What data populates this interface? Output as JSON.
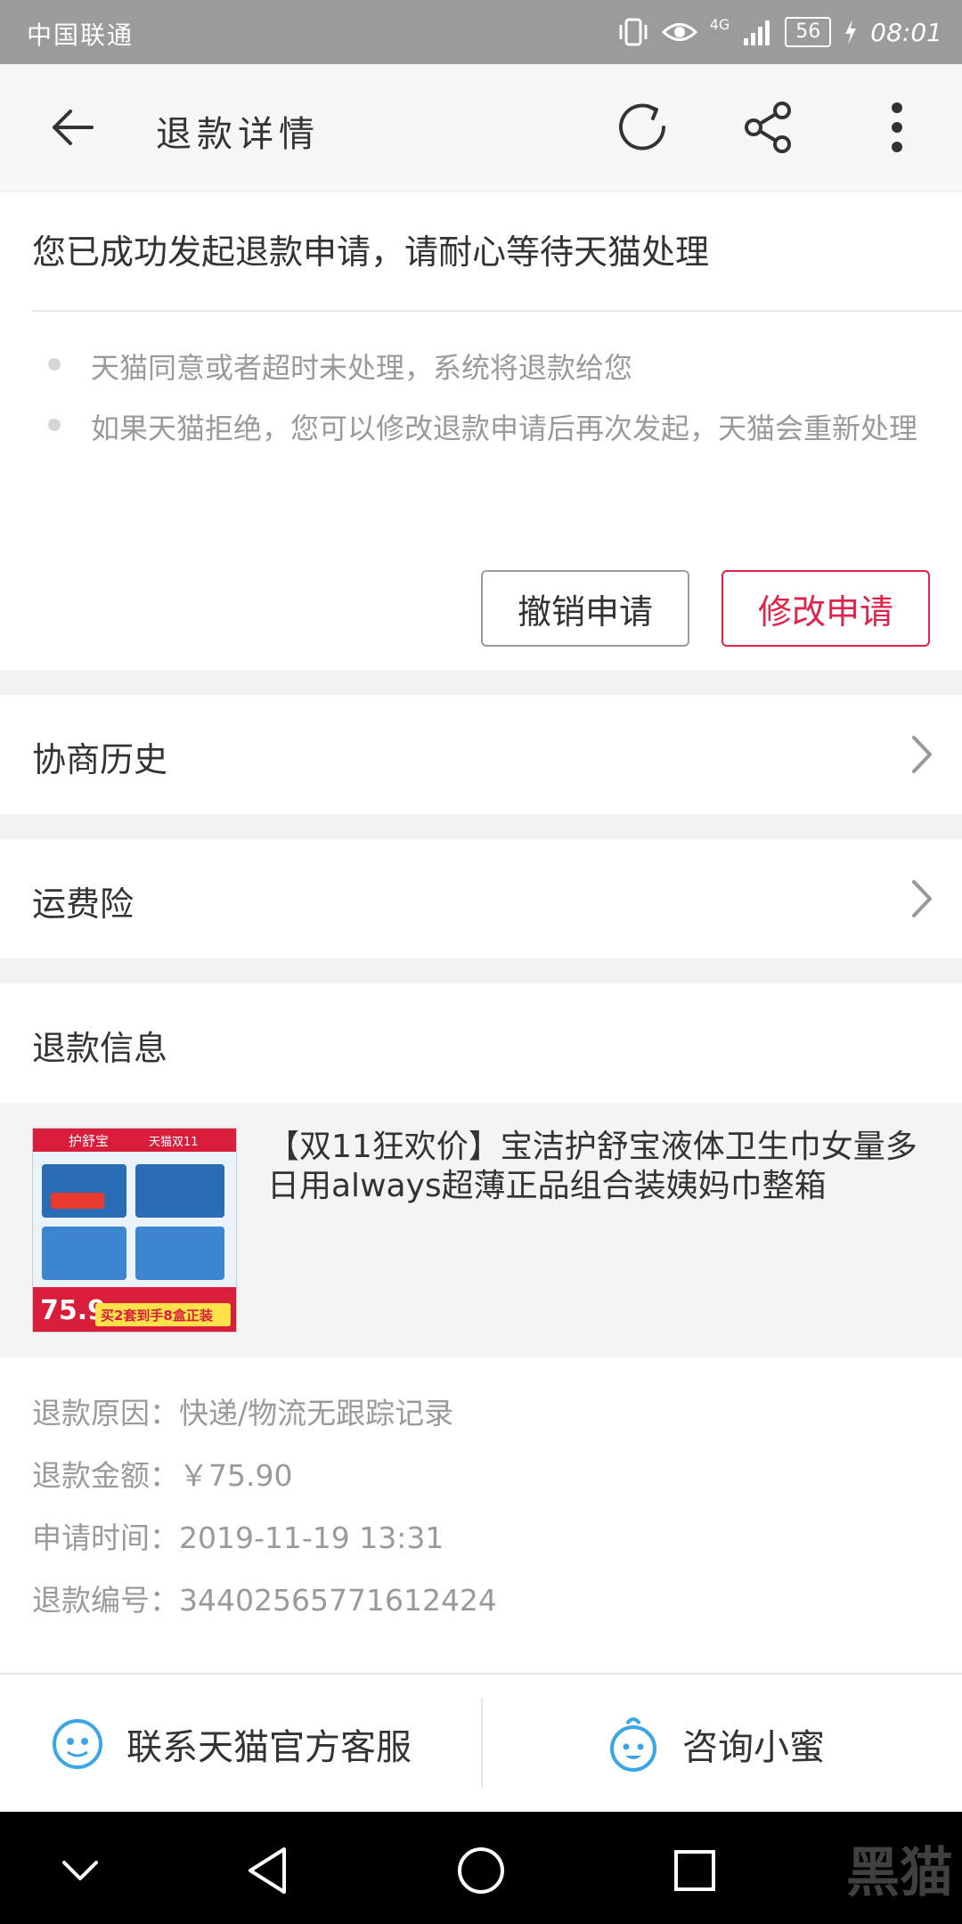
{
  "statusbar": {
    "carrier": "中国联通",
    "network": "4G",
    "battery": "56",
    "time": "08:01"
  },
  "header": {
    "title": "退款详情"
  },
  "notice": {
    "headline": "您已成功发起退款申请，请耐心等待天猫处理",
    "bullets": [
      "天猫同意或者超时未处理，系统将退款给您",
      "如果天猫拒绝，您可以修改退款申请后再次发起，天猫会重新处理"
    ],
    "cancel_label": "撤销申请",
    "modify_label": "修改申请"
  },
  "rows": {
    "history": "协商历史",
    "shipping_insurance": "运费险"
  },
  "refund_info": {
    "section_title": "退款信息",
    "product_title": "【双11狂欢价】宝洁护舒宝液体卫生巾女量多日用always超薄正品组合装姨妈巾整箱",
    "product_image": {
      "brand": "护舒宝",
      "badge": "天猫双11",
      "price": "75.9",
      "promo": "买2套到手8盒正装"
    },
    "reason_key": "退款原因：",
    "reason_val": "快递/物流无跟踪记录",
    "amount_key": "退款金额：",
    "amount_val": "￥75.90",
    "time_key": "申请时间：",
    "time_val": "2019-11-19 13:31",
    "id_key": "退款编号：",
    "id_val": "34402565771612424"
  },
  "bottombar": {
    "service_label": "联系天猫官方客服",
    "assistant_label": "咨询小蜜"
  },
  "watermark": "黑猫",
  "colors": {
    "accent": "#e0234a",
    "icon_blue": "#3aa6e6"
  }
}
